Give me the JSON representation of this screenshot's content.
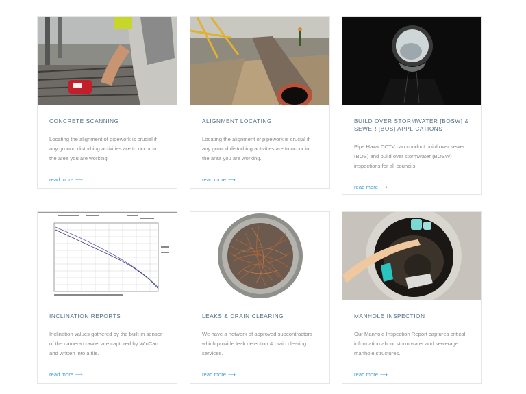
{
  "cards": [
    {
      "title": "CONCRETE SCANNING",
      "desc": "Locating the alignment of pipework is crucial if any ground disturbing activities are to occur in the area you are working.",
      "link": "read more",
      "image_icon": "concrete-scanning-photo"
    },
    {
      "title": "ALIGNMENT LOCATING",
      "desc": "Locating the alignment of pipework is crucial if any ground disturbing activities are to occur in the area you are working.",
      "link": "read more",
      "image_icon": "pipe-alignment-photo"
    },
    {
      "title": "BUILD OVER STORMWATER [BOSW] & SEWER [BOS] APPLICATIONS",
      "desc": "Pipe Hawk CCTV can conduct build over sewer (BOS) and build over stormwater (BOSW) inspections for all councils.",
      "link": "read more",
      "image_icon": "stormwater-tunnel-photo"
    },
    {
      "title": "INCLINATION REPORTS",
      "desc": "Inclination values gathered by the built-in sensor of the camera crawler are captured by WinCan and written into a file.",
      "link": "read more",
      "image_icon": "inclination-graph-image"
    },
    {
      "title": "LEAKS & DRAIN CLEARING",
      "desc": "We have a network of approved subcontractors which provide leak detection & drain clearing services.",
      "link": "read more",
      "image_icon": "root-blocked-pipe-photo"
    },
    {
      "title": "MANHOLE INSPECTION",
      "desc": "Our Manhole Inspection Report captures critical information about storm water and sewerage manhole structures.",
      "link": "read more",
      "image_icon": "manhole-photo"
    }
  ],
  "link_arrow": "⟶",
  "colors": {
    "title": "#4f6f86",
    "text": "#8a8a8a",
    "link": "#3f9dd6",
    "border": "#e6e6e6"
  }
}
